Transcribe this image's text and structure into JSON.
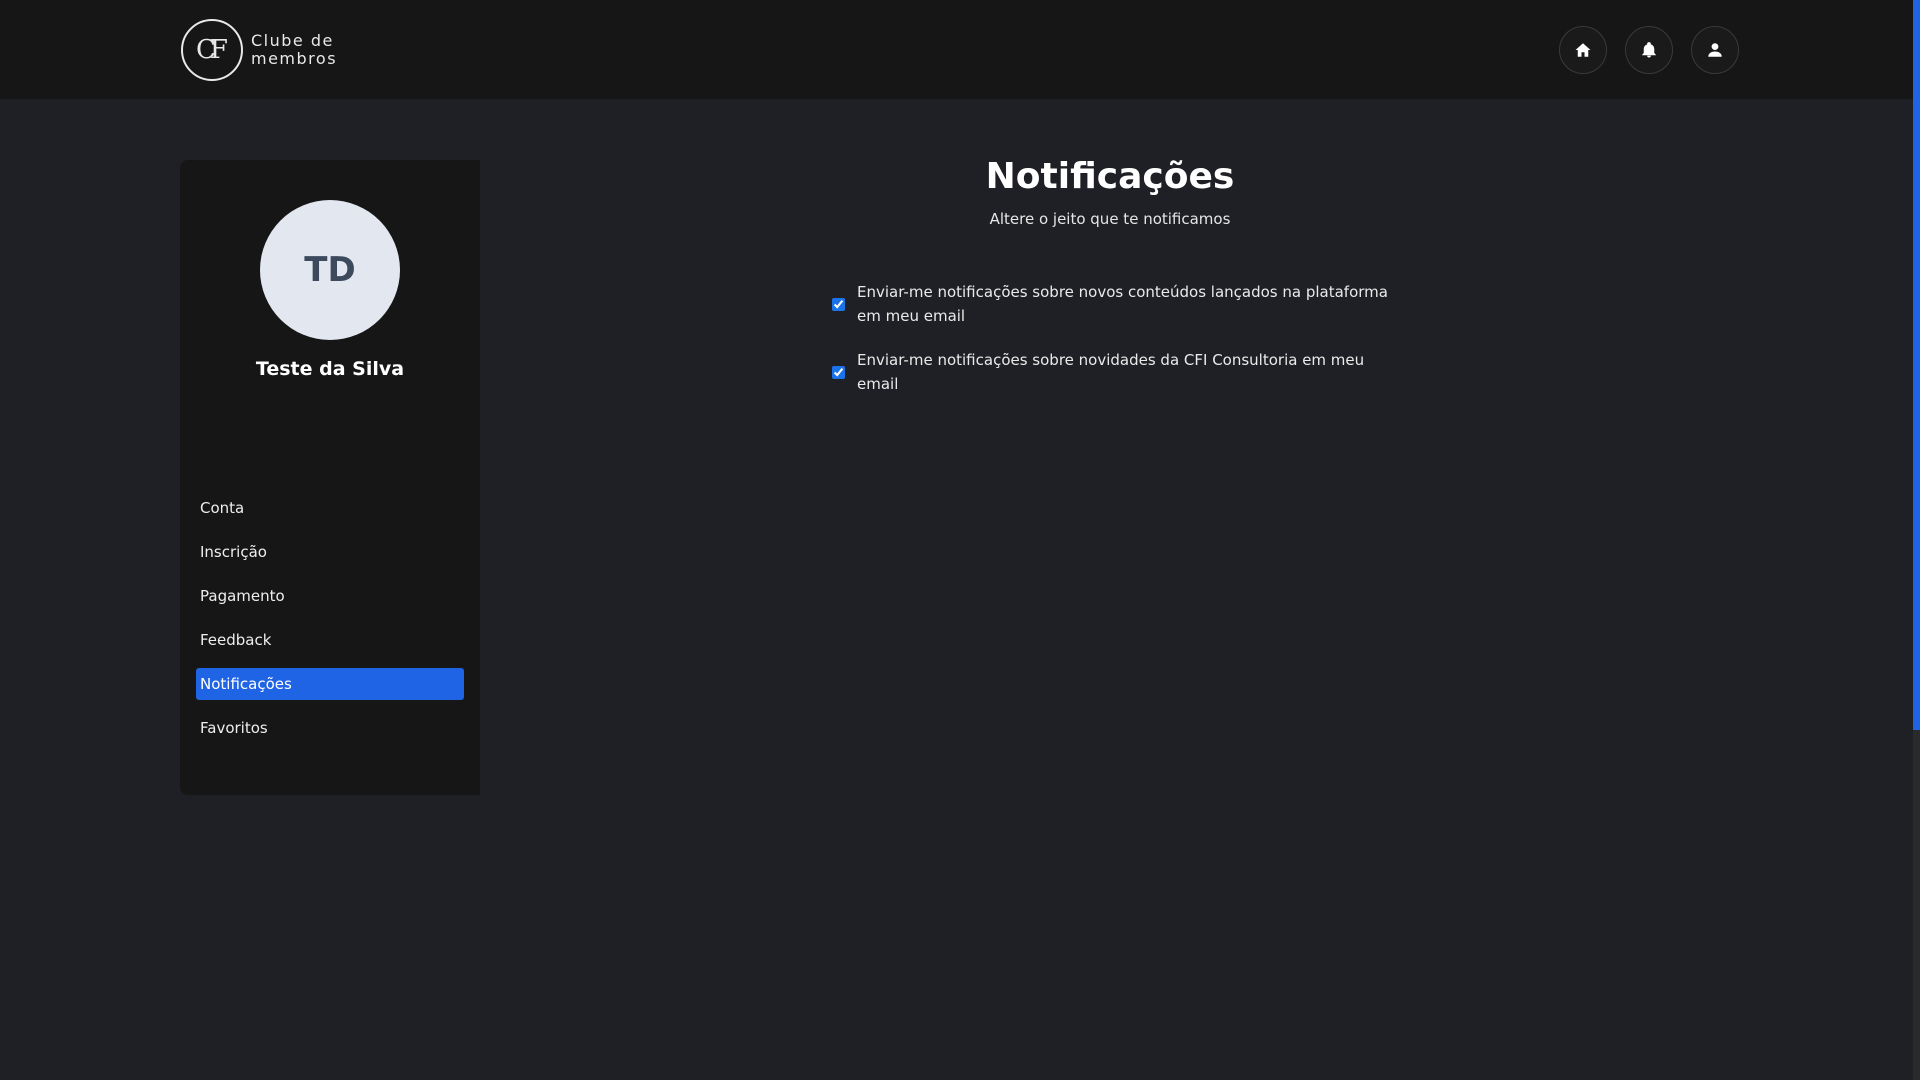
{
  "header": {
    "logo": {
      "mark": "CF",
      "line1": "Clube de",
      "line2": "membros"
    },
    "icons": [
      "home-icon",
      "bell-icon",
      "user-icon"
    ]
  },
  "sidebar": {
    "avatar_initials": "TD",
    "user_name": "Teste da Silva",
    "items": [
      {
        "label": "Conta",
        "active": false
      },
      {
        "label": "Inscrição",
        "active": false
      },
      {
        "label": "Pagamento",
        "active": false
      },
      {
        "label": "Feedback",
        "active": false
      },
      {
        "label": "Notificações",
        "active": true
      },
      {
        "label": "Favoritos",
        "active": false
      }
    ]
  },
  "main": {
    "title": "Notificações",
    "subtitle": "Altere o jeito que te notificamos",
    "options": [
      {
        "label": "Enviar-me notificações sobre novos conteúdos lançados na plataforma em meu email",
        "checked": true
      },
      {
        "label": "Enviar-me notificações sobre novidades da CFI Consultoria em meu email",
        "checked": true
      }
    ]
  },
  "colors": {
    "background": "#1f2025",
    "header": "#161616",
    "sidebar": "#161616",
    "accent": "#2064e6",
    "avatar_bg": "#e3e8f0",
    "avatar_text": "#3d4a5e"
  }
}
